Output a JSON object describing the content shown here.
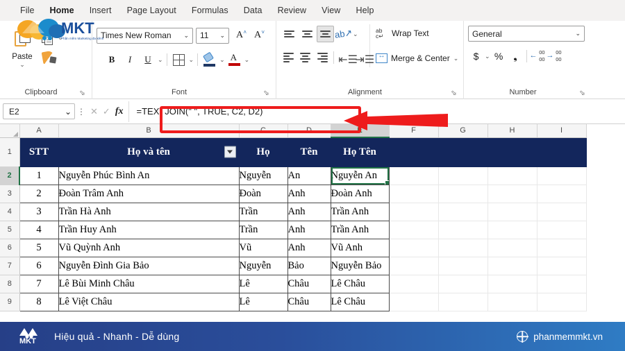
{
  "ribbon": {
    "tabs": [
      {
        "label": "File",
        "active": false
      },
      {
        "label": "Home",
        "active": true
      },
      {
        "label": "Insert",
        "active": false
      },
      {
        "label": "Page Layout",
        "active": false
      },
      {
        "label": "Formulas",
        "active": false
      },
      {
        "label": "Data",
        "active": false
      },
      {
        "label": "Review",
        "active": false
      },
      {
        "label": "View",
        "active": false
      },
      {
        "label": "Help",
        "active": false
      }
    ],
    "clipboard": {
      "group_label": "Clipboard",
      "paste_label": "Paste",
      "copy_name": "copy-icon",
      "format_painter_name": "format-painter-icon"
    },
    "font": {
      "group_label": "Font",
      "font_name": "Times New Roman",
      "font_size": "11",
      "bold": "B",
      "italic": "I",
      "underline": "U",
      "grow_font": "A",
      "shrink_font": "A",
      "font_color_letter": "A"
    },
    "alignment": {
      "group_label": "Alignment",
      "wrap_text": "Wrap Text",
      "merge_center": "Merge & Center",
      "wrap_glyph_top": "ab",
      "wrap_glyph_bottom": "c"
    },
    "number": {
      "group_label": "Number",
      "format": "General",
      "currency": "$",
      "percent": "%",
      "comma": "❟",
      "dec_zeros": "00"
    }
  },
  "formula_bar": {
    "name_box": "E2",
    "cancel": "✕",
    "enter": "✓",
    "fx": "fx",
    "formula": "=TEXTJOIN(\" \", TRUE, C2, D2)"
  },
  "grid": {
    "column_headers": [
      "A",
      "B",
      "C",
      "D",
      "E",
      "F",
      "G",
      "H",
      "I"
    ],
    "selected_column": "E",
    "selected_row": "2",
    "selected_cell": "E2",
    "row_numbers": [
      "1",
      "2",
      "3",
      "4",
      "5",
      "6",
      "7",
      "8",
      "9"
    ],
    "table_headers": [
      "STT",
      "Họ và tên",
      "Họ",
      "Tên",
      "Họ Tên"
    ],
    "rows": [
      {
        "stt": "1",
        "fullname": "Nguyễn Phúc Bình An",
        "ho": "Nguyễn",
        "ten": "An",
        "hoten": "Nguyễn An"
      },
      {
        "stt": "2",
        "fullname": "Đoàn Trâm Anh",
        "ho": "Đoàn",
        "ten": "Anh",
        "hoten": "Đoàn Anh"
      },
      {
        "stt": "3",
        "fullname": "Trần Hà Anh",
        "ho": "Trần",
        "ten": "Anh",
        "hoten": "Trần Anh"
      },
      {
        "stt": "4",
        "fullname": "Trần Huy Anh",
        "ho": "Trần",
        "ten": "Anh",
        "hoten": "Trần Anh"
      },
      {
        "stt": "5",
        "fullname": "Vũ Quỳnh Anh",
        "ho": "Vũ",
        "ten": "Anh",
        "hoten": "Vũ Anh"
      },
      {
        "stt": "6",
        "fullname": "Nguyễn Đình Gia Bảo",
        "ho": "Nguyễn",
        "ten": "Bảo",
        "hoten": "Nguyễn Bảo"
      },
      {
        "stt": "7",
        "fullname": "Lê Bùi Minh Châu",
        "ho": "Lê",
        "ten": "Châu",
        "hoten": "Lê Châu"
      },
      {
        "stt": "8",
        "fullname": "Lê Việt Châu",
        "ho": "Lê",
        "ten": "Châu",
        "hoten": "Lê Châu"
      }
    ]
  },
  "footer": {
    "brand": "MKT",
    "tagline": "Hiệu quả - Nhanh - Dễ dùng",
    "website": "phanmemmkt.vn"
  },
  "watermark": {
    "brand": "MKT",
    "subtitle": "Phần mềm Marketing đa kênh"
  },
  "colors": {
    "accent_green": "#217346",
    "table_header_bg": "#13265c",
    "annotation_red": "#ee1c1c",
    "footer_blue": "#2a4e9b"
  }
}
